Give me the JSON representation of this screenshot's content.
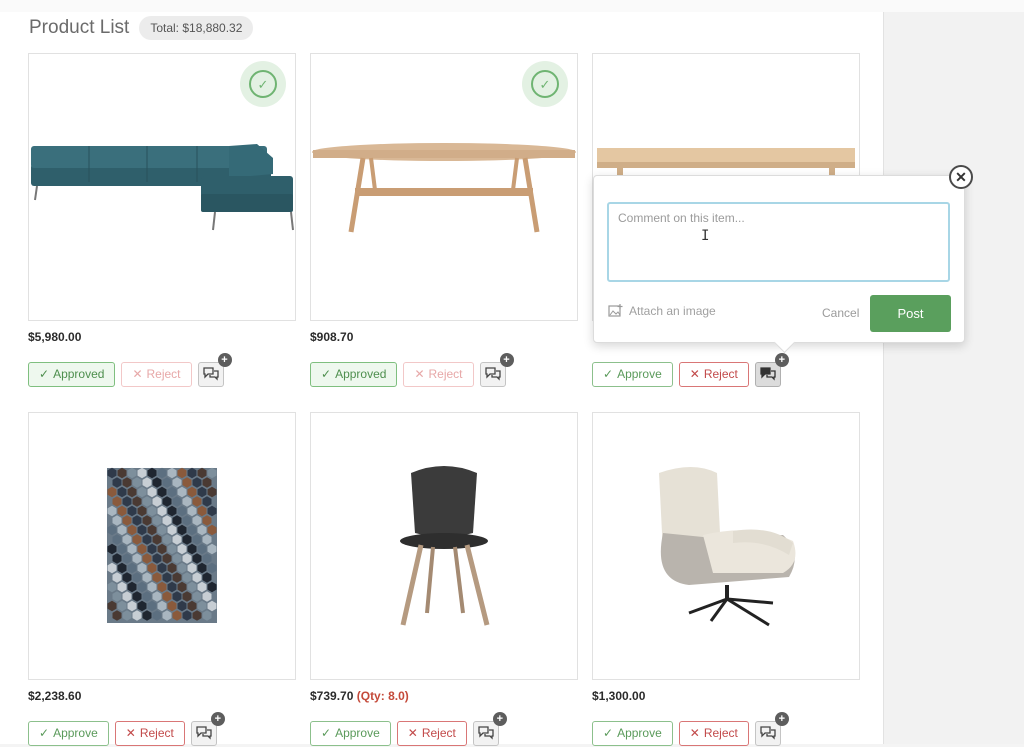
{
  "header": {
    "title": "Product List",
    "total": "Total: $18,880.32"
  },
  "products": [
    {
      "price": "$5,980.00",
      "qty": "",
      "approve_label": "Approved",
      "reject_label": "Reject",
      "approved": true,
      "image_icon": "sectional-sofa"
    },
    {
      "price": "$908.70",
      "qty": "",
      "approve_label": "Approved",
      "reject_label": "Reject",
      "approved": true,
      "image_icon": "coffee-table"
    },
    {
      "price": "",
      "qty": "",
      "approve_label": "Approve",
      "reject_label": "Reject",
      "approved": false,
      "image_icon": "dining-table"
    },
    {
      "price": "$2,238.60",
      "qty": "",
      "approve_label": "Approve",
      "reject_label": "Reject",
      "approved": false,
      "image_icon": "hexagon-rug"
    },
    {
      "price": "$739.70",
      "qty": "(Qty: 8.0)",
      "approve_label": "Approve",
      "reject_label": "Reject",
      "approved": false,
      "image_icon": "dining-chair"
    },
    {
      "price": "$1,300.00",
      "qty": "",
      "approve_label": "Approve",
      "reject_label": "Reject",
      "approved": false,
      "image_icon": "lounge-chair"
    }
  ],
  "comment_popover": {
    "placeholder": "Comment on this item...",
    "attach_label": "Attach an image",
    "cancel_label": "Cancel",
    "post_label": "Post"
  },
  "colors": {
    "approve_green": "#5a9f5d",
    "reject_red": "#c24a4a",
    "qty_red": "#c44a3a"
  }
}
